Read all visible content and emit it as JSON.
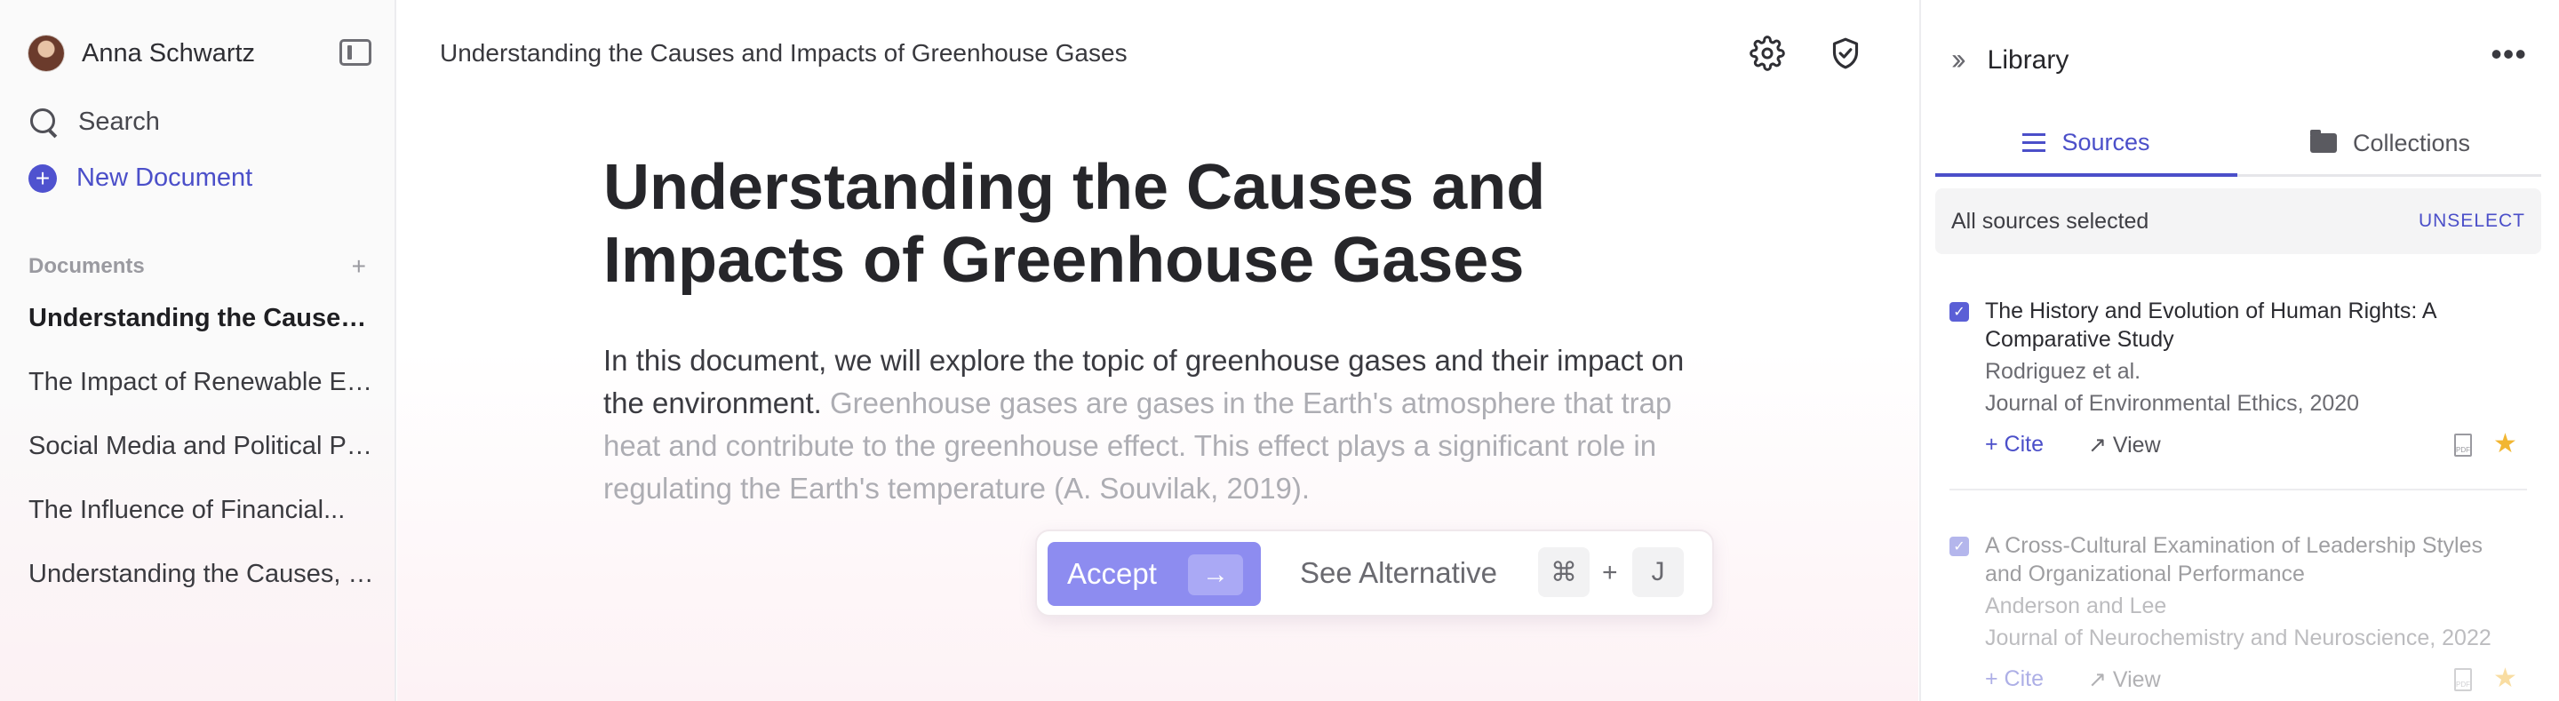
{
  "sidebar": {
    "user_name": "Anna Schwartz",
    "search_label": "Search",
    "new_document_label": "New Document",
    "documents_header": "Documents",
    "documents_add": "+",
    "documents": [
      {
        "title": "Understanding the Causes and Impacts of Greenhouse Gases",
        "active": true
      },
      {
        "title": "The Impact of Renewable Energy",
        "active": false
      },
      {
        "title": "Social Media and Political Polarization",
        "active": false
      },
      {
        "title": "The Influence of Financial...",
        "active": false
      },
      {
        "title": "Understanding the Causes, Effects",
        "active": false
      }
    ]
  },
  "main": {
    "breadcrumb": "Understanding the Causes and Impacts of Greenhouse Gases",
    "title": "Understanding the Causes and Impacts of Greenhouse Gases",
    "body_text": "In this document, we will explore the topic of greenhouse gases and their impact on the environment.",
    "suggestion_text": "Greenhouse gases are gases in the Earth's atmosphere that trap heat and contribute to the greenhouse effect. This effect plays a significant role in regulating the Earth's temperature (A. Souvilak, 2019).",
    "ai_bar": {
      "accept_label": "Accept",
      "accept_arrow": "→",
      "alternative_label": "See Alternative",
      "shortcut_key1": "⌘",
      "shortcut_plus": "+",
      "shortcut_key2": "J"
    }
  },
  "panel": {
    "title": "Library",
    "more": "•••",
    "tabs": [
      {
        "label": "Sources",
        "active": true
      },
      {
        "label": "Collections",
        "active": false
      }
    ],
    "selection_text": "All sources selected",
    "unselect_label": "UNSELECT",
    "sources": [
      {
        "title": "The History and Evolution of Human Rights: A Comparative Study",
        "authors": "Rodriguez et al.",
        "journal": "Journal of Environmental Ethics, 2020",
        "cite_label": "+ Cite",
        "view_label": "↗ View",
        "pdf_label": "PDF",
        "starred": true
      },
      {
        "title": "A Cross-Cultural Examination of Leadership Styles and Organizational Performance",
        "authors": "Anderson and Lee",
        "journal": "Journal of Neurochemistry and Neuroscience, 2022",
        "cite_label": "+ Cite",
        "view_label": "↗ View",
        "pdf_label": "PDF",
        "starred": true
      }
    ]
  },
  "icons": {
    "collapse": "sidebar-collapse-icon",
    "search": "search-icon",
    "new_doc": "plus-circle-icon",
    "settings": "gear-icon",
    "security": "shield-check-icon",
    "expand_panel": "double-chevron-right-icon",
    "more": "more-horizontal-icon",
    "sources_tab": "list-icon",
    "collections_tab": "folder-icon",
    "pdf": "pdf-file-icon",
    "star": "star-icon"
  },
  "colors": {
    "accent": "#4b4fc9",
    "accept_button": "#8d8cf0",
    "star": "#f2b632",
    "suggestion_text": "#adadb3"
  }
}
